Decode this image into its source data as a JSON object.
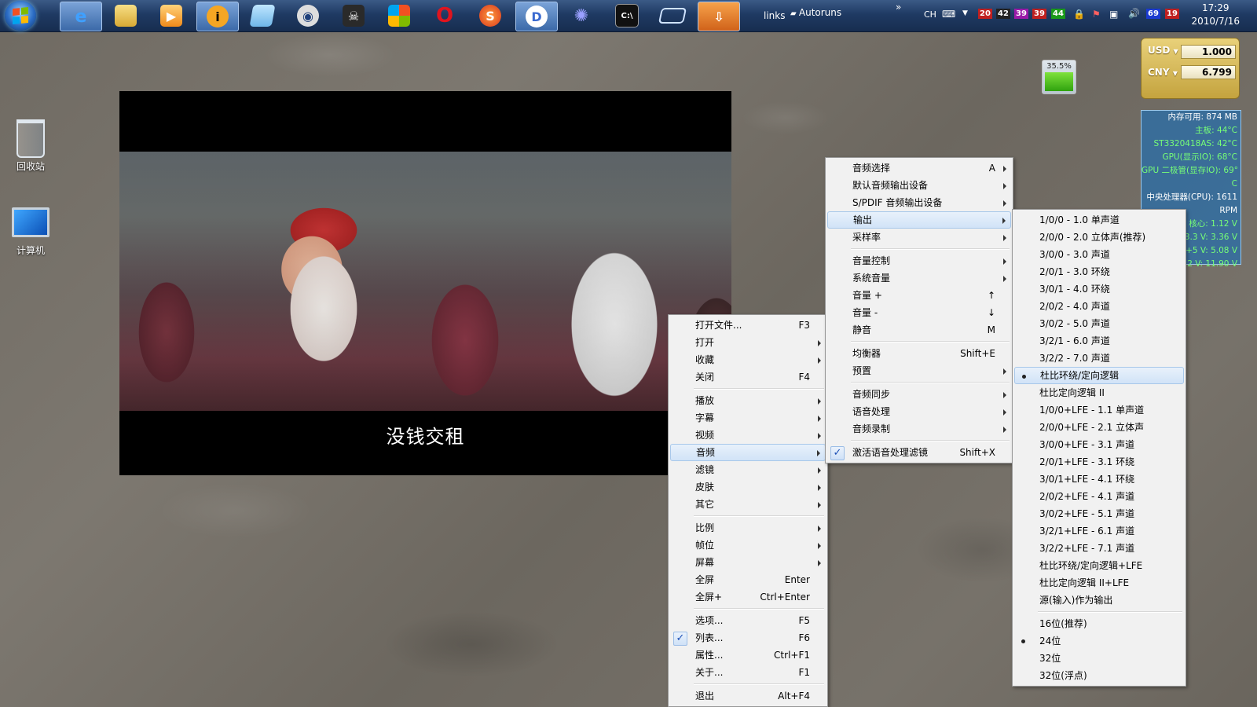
{
  "taskbar": {
    "links_label": "links",
    "autoruns_label": "Autoruns",
    "chevron": "»",
    "lang": "CH",
    "tray_numbers": [
      {
        "value": "20",
        "color": "#c02020"
      },
      {
        "value": "42",
        "color": "#222222"
      },
      {
        "value": "39",
        "color": "#9a1aa8"
      },
      {
        "value": "39",
        "color": "#c02020"
      },
      {
        "value": "44",
        "color": "#1a9a1a"
      },
      {
        "value": "69",
        "color": "#1a3ad0"
      },
      {
        "value": "19",
        "color": "#c02020"
      }
    ],
    "clock_time": "17:29",
    "clock_date": "2010/7/16"
  },
  "desktop": {
    "recycle_bin": "回收站",
    "computer": "计算机"
  },
  "video": {
    "subtitle": "没钱交租"
  },
  "widgets": {
    "cpu_percent": "35.5%",
    "cpu_fill_fraction": 0.355,
    "currency": [
      {
        "code": "USD",
        "value": "1.000"
      },
      {
        "code": "CNY",
        "value": "6.799"
      }
    ],
    "sensors": [
      {
        "text": "内存可用: 874 MB",
        "cls": "w"
      },
      {
        "text": "主板: 44°C",
        "cls": ""
      },
      {
        "text": "ST3320418AS: 42°C",
        "cls": ""
      },
      {
        "text": "GPU(显示IO): 68°C",
        "cls": ""
      },
      {
        "text": "GPU 二极管(显存IO): 69°",
        "cls": ""
      },
      {
        "text": "C",
        "cls": ""
      },
      {
        "text": "中央处理器(CPU): 1611",
        "cls": "w"
      },
      {
        "text": "RPM",
        "cls": "w"
      },
      {
        "text": "核心: 1.12 V",
        "cls": ""
      },
      {
        "text": "3.3 V: 3.36 V",
        "cls": ""
      },
      {
        "text": "+5 V: 5.08 V",
        "cls": ""
      },
      {
        "text": "12 V: 11.90 V",
        "cls": ""
      }
    ]
  },
  "main_menu": [
    {
      "label": "打开文件...",
      "shortcut": "F3"
    },
    {
      "label": "打开",
      "submenu": true
    },
    {
      "label": "收藏",
      "submenu": true
    },
    {
      "label": "关闭",
      "shortcut": "F4"
    },
    {
      "sep": true
    },
    {
      "label": "播放",
      "submenu": true
    },
    {
      "label": "字幕",
      "submenu": true
    },
    {
      "label": "视频",
      "submenu": true
    },
    {
      "label": "音频",
      "submenu": true,
      "highlight": true
    },
    {
      "label": "滤镜",
      "submenu": true
    },
    {
      "label": "皮肤",
      "submenu": true
    },
    {
      "label": "其它",
      "submenu": true
    },
    {
      "sep": true
    },
    {
      "label": "比例",
      "submenu": true
    },
    {
      "label": "帧位",
      "submenu": true
    },
    {
      "label": "屏幕",
      "submenu": true
    },
    {
      "label": "全屏",
      "shortcut": "Enter"
    },
    {
      "label": "全屏+",
      "shortcut": "Ctrl+Enter"
    },
    {
      "sep": true
    },
    {
      "label": "选项...",
      "shortcut": "F5"
    },
    {
      "label": "列表...",
      "shortcut": "F6",
      "checked": true
    },
    {
      "label": "属性...",
      "shortcut": "Ctrl+F1"
    },
    {
      "label": "关于...",
      "shortcut": "F1"
    },
    {
      "sep": true
    },
    {
      "label": "退出",
      "shortcut": "Alt+F4"
    }
  ],
  "audio_menu": [
    {
      "label": "音频选择",
      "shortcut": "A",
      "submenu": true
    },
    {
      "label": "默认音频输出设备",
      "submenu": true
    },
    {
      "label": "S/PDIF 音频输出设备",
      "submenu": true
    },
    {
      "label": "输出",
      "submenu": true,
      "highlight": true
    },
    {
      "label": "采样率",
      "submenu": true
    },
    {
      "sep": true
    },
    {
      "label": "音量控制",
      "submenu": true
    },
    {
      "label": "系统音量",
      "submenu": true
    },
    {
      "label": "音量 +",
      "shortcut": "↑"
    },
    {
      "label": "音量 -",
      "shortcut": "↓"
    },
    {
      "label": "静音",
      "shortcut": "M"
    },
    {
      "sep": true
    },
    {
      "label": "均衡器",
      "shortcut": "Shift+E"
    },
    {
      "label": "预置",
      "submenu": true
    },
    {
      "sep": true
    },
    {
      "label": "音频同步",
      "submenu": true
    },
    {
      "label": "语音处理",
      "submenu": true
    },
    {
      "label": "音频录制",
      "submenu": true
    },
    {
      "sep": true
    },
    {
      "label": "激活语音处理滤镜",
      "shortcut": "Shift+X",
      "checked": true
    }
  ],
  "output_menu": [
    {
      "label": "1/0/0 - 1.0 单声道"
    },
    {
      "label": "2/0/0 - 2.0 立体声(推荐)"
    },
    {
      "label": "3/0/0 - 3.0 声道"
    },
    {
      "label": "2/0/1 - 3.0 环绕"
    },
    {
      "label": "3/0/1 - 4.0 环绕"
    },
    {
      "label": "2/0/2 - 4.0 声道"
    },
    {
      "label": "3/0/2 - 5.0 声道"
    },
    {
      "label": "3/2/1 - 6.0 声道"
    },
    {
      "label": "3/2/2 - 7.0 声道"
    },
    {
      "label": "杜比环绕/定向逻辑",
      "radio": true,
      "highlight": true
    },
    {
      "label": "杜比定向逻辑 II"
    },
    {
      "label": "1/0/0+LFE - 1.1 单声道"
    },
    {
      "label": "2/0/0+LFE - 2.1 立体声"
    },
    {
      "label": "3/0/0+LFE - 3.1 声道"
    },
    {
      "label": "2/0/1+LFE - 3.1 环绕"
    },
    {
      "label": "3/0/1+LFE - 4.1 环绕"
    },
    {
      "label": "2/0/2+LFE - 4.1 声道"
    },
    {
      "label": "3/0/2+LFE - 5.1 声道"
    },
    {
      "label": "3/2/1+LFE - 6.1 声道"
    },
    {
      "label": "3/2/2+LFE - 7.1 声道"
    },
    {
      "label": "杜比环绕/定向逻辑+LFE"
    },
    {
      "label": "杜比定向逻辑 II+LFE"
    },
    {
      "label": "源(输入)作为输出"
    },
    {
      "sep": true
    },
    {
      "label": "16位(推荐)"
    },
    {
      "label": "24位",
      "radio": true
    },
    {
      "label": "32位"
    },
    {
      "label": "32位(浮点)"
    }
  ]
}
